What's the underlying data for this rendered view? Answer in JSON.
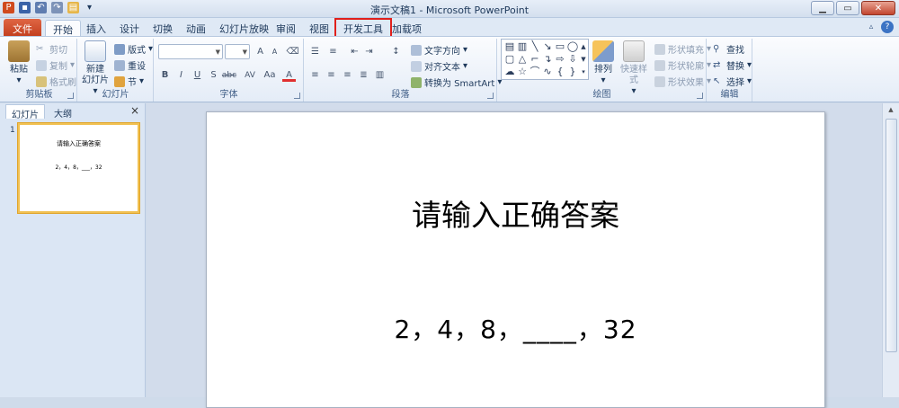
{
  "window": {
    "title": "演示文稿1 - Microsoft PowerPoint"
  },
  "tabs": [
    {
      "label": "文件"
    },
    {
      "label": "开始"
    },
    {
      "label": "插入"
    },
    {
      "label": "设计"
    },
    {
      "label": "切换"
    },
    {
      "label": "动画"
    },
    {
      "label": "幻灯片放映"
    },
    {
      "label": "审阅"
    },
    {
      "label": "视图"
    },
    {
      "label": "开发工具"
    },
    {
      "label": "加载项"
    }
  ],
  "ribbon": {
    "clipboard": {
      "label": "剪贴板",
      "paste": "粘贴",
      "cut": "剪切",
      "copy": "复制",
      "format_painter": "格式刷"
    },
    "slides": {
      "label": "幻灯片",
      "new_slide": "新建",
      "new_slide2": "幻灯片",
      "layout": "版式",
      "reset": "重设",
      "section": "节"
    },
    "font": {
      "label": "字体",
      "bold": "B",
      "italic": "I",
      "underline": "U",
      "shadow": "S",
      "strike": "abc",
      "spacing": "AV",
      "case": "Aa",
      "font_color": "A",
      "grow": "A",
      "shrink": "A"
    },
    "paragraph": {
      "label": "段落",
      "text_direction": "文字方向",
      "align_text": "对齐文本",
      "smartart": "转换为 SmartArt"
    },
    "drawing": {
      "label": "绘图",
      "arrange": "排列",
      "quick_styles": "快速样式",
      "shape_fill": "形状填充",
      "shape_outline": "形状轮廓",
      "shape_effects": "形状效果"
    },
    "editing": {
      "label": "编辑",
      "find": "查找",
      "replace": "替换",
      "select": "选择"
    }
  },
  "pane": {
    "tabs": [
      "幻灯片",
      "大纲"
    ],
    "close": "×",
    "slide_number": "1",
    "thumb_title": "请输入正确答案",
    "thumb_body": "2，4，8，___，32"
  },
  "slide": {
    "title": "请输入正确答案",
    "body": "2，4，8，____，32"
  },
  "colors": {
    "file_tab": "#c3401f",
    "highlight": "#e0201b",
    "thumb_border": "#f1c153"
  }
}
